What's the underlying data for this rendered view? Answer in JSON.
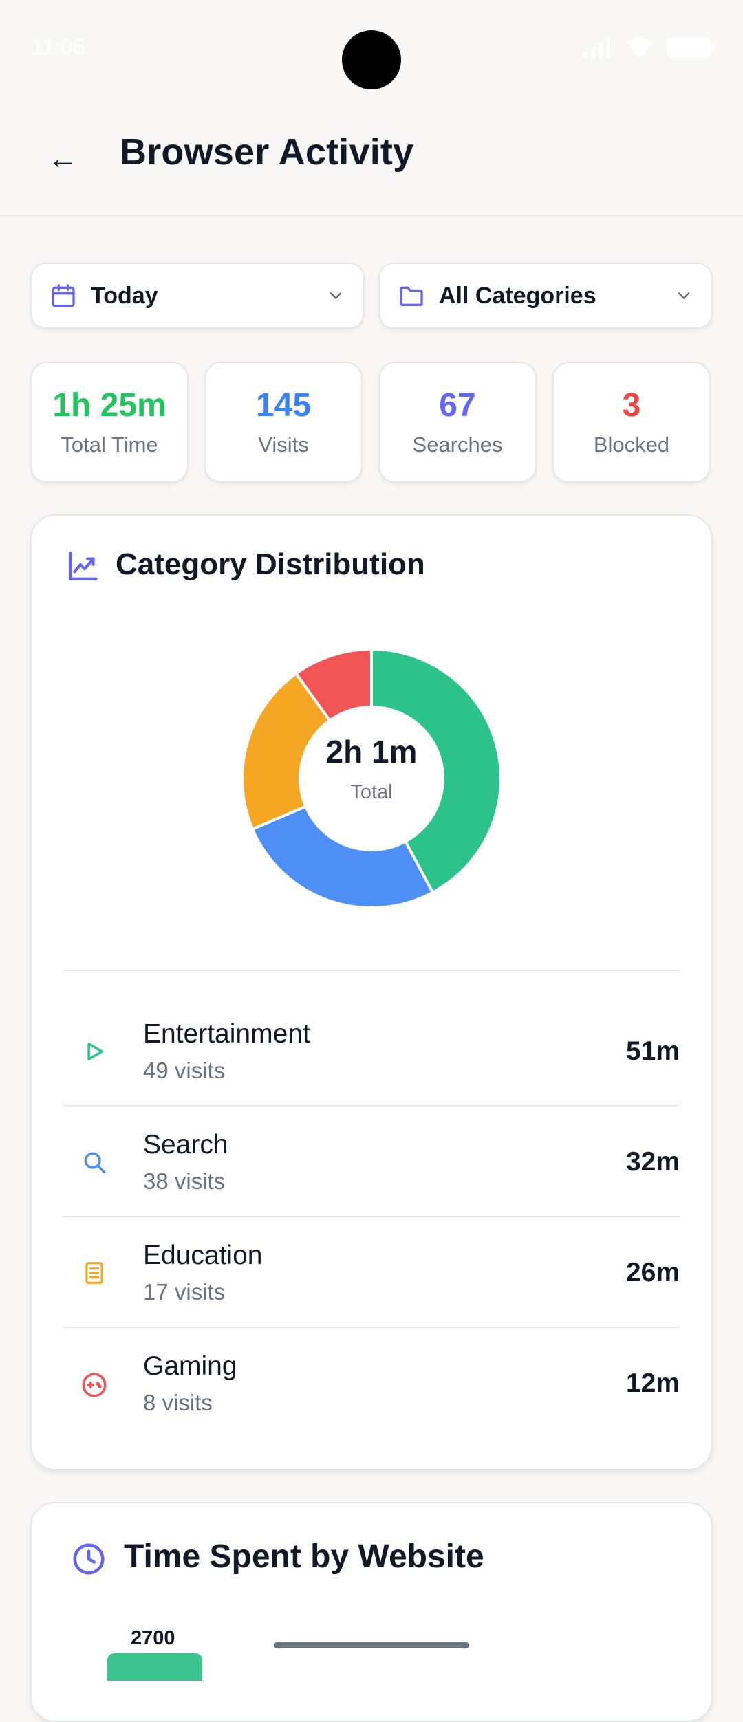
{
  "status_bar": {
    "time": "11:06"
  },
  "header": {
    "back_label": "←",
    "title": "Browser Activity"
  },
  "filters": {
    "date": {
      "label": "Today",
      "icon": "calendar-icon"
    },
    "category": {
      "label": "All Categories",
      "icon": "folder-icon"
    }
  },
  "stats": [
    {
      "value": "1h 25m",
      "label": "Total Time",
      "color": "#22c55e"
    },
    {
      "value": "145",
      "label": "Visits",
      "color": "#3b82f6"
    },
    {
      "value": "67",
      "label": "Searches",
      "color": "#6366f1"
    },
    {
      "value": "3",
      "label": "Blocked",
      "color": "#ef4444"
    }
  ],
  "category_card": {
    "title": "Category Distribution",
    "icon": "trend-chart-icon",
    "donut": {
      "center_value": "2h 1m",
      "center_label": "Total"
    },
    "items": [
      {
        "name": "Entertainment",
        "visits": "49 visits",
        "time": "51m",
        "minutes": 51,
        "color": "#2bc28b",
        "icon": "play-icon"
      },
      {
        "name": "Search",
        "visits": "38 visits",
        "time": "32m",
        "minutes": 32,
        "color": "#4e8ff5",
        "icon": "search-icon"
      },
      {
        "name": "Education",
        "visits": "17 visits",
        "time": "26m",
        "minutes": 26,
        "color": "#f5a623",
        "icon": "book-icon"
      },
      {
        "name": "Gaming",
        "visits": "8 visits",
        "time": "12m",
        "minutes": 12,
        "color": "#f05454",
        "icon": "gamepad-icon"
      }
    ]
  },
  "website_card": {
    "title": "Time Spent by Website",
    "icon": "clock-icon",
    "first_bar_value": "2700"
  }
}
